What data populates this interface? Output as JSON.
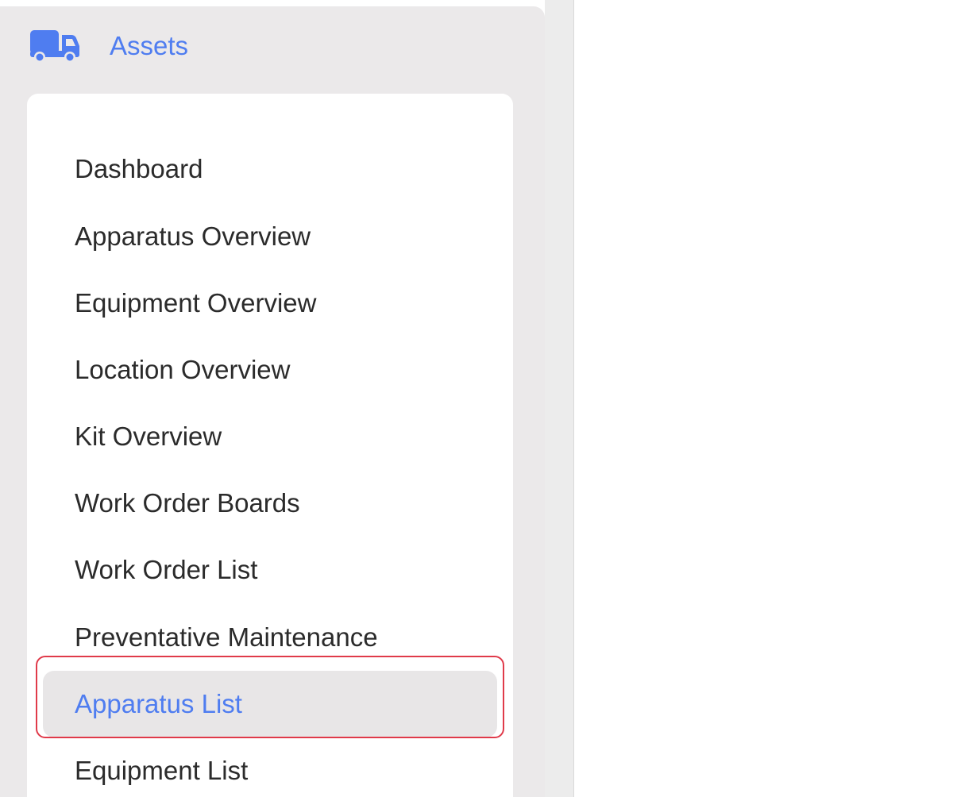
{
  "header": {
    "title": "Assets",
    "icon": "truck-icon",
    "accent_color": "#4f7df0"
  },
  "menu": {
    "items": [
      {
        "label": "Dashboard"
      },
      {
        "label": "Apparatus Overview"
      },
      {
        "label": "Equipment Overview"
      },
      {
        "label": "Location Overview"
      },
      {
        "label": "Kit Overview"
      },
      {
        "label": "Work Order Boards"
      },
      {
        "label": "Work Order List"
      },
      {
        "label": "Preventative Maintenance"
      },
      {
        "label": "Apparatus List"
      },
      {
        "label": "Equipment List"
      }
    ],
    "selected_index": 8,
    "highlight_color": "#e03a4a"
  }
}
